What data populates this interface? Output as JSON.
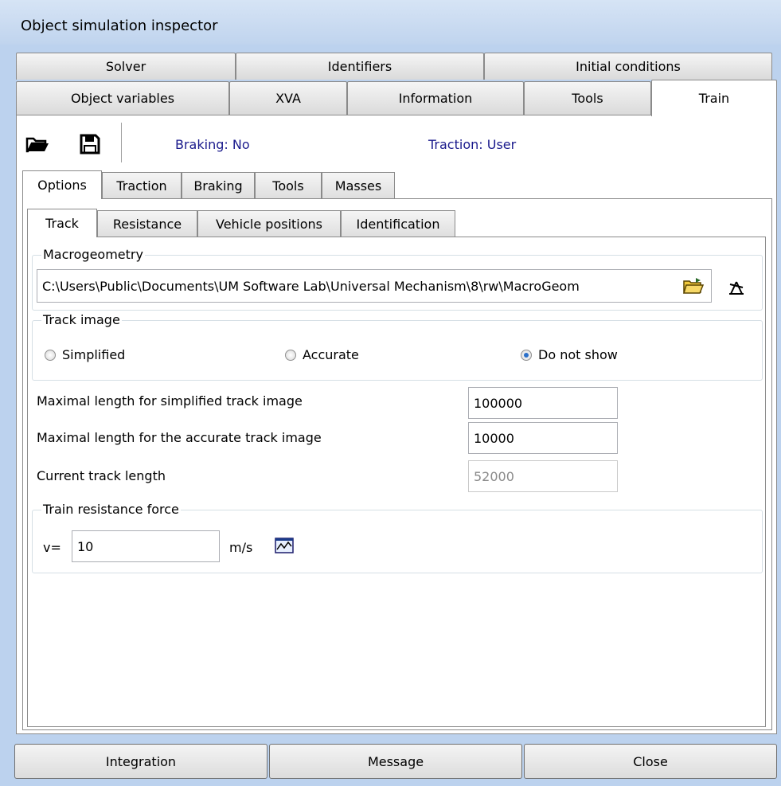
{
  "window": {
    "title": "Object simulation inspector"
  },
  "main_tabs_row1": [
    "Solver",
    "Identifiers",
    "Initial conditions"
  ],
  "main_tabs_row2": [
    "Object variables",
    "XVA",
    "Information",
    "Tools",
    "Train"
  ],
  "toolbar": {
    "open_icon": "folder-open-icon",
    "save_icon": "save-icon",
    "braking_status": "Braking: No",
    "traction_status": "Traction: User"
  },
  "sub_tabs": [
    "Options",
    "Traction",
    "Braking",
    "Tools",
    "Masses"
  ],
  "inner_tabs": [
    "Track",
    "Resistance",
    "Vehicle positions",
    "Identification"
  ],
  "macrogeometry": {
    "title": "Macrogeometry",
    "path": "C:\\Users\\Public\\Documents\\UM Software Lab\\Universal Mechanism\\8\\rw\\MacroGeom",
    "browse_icon": "folder-browse-icon",
    "view_icon": "track-geometry-icon"
  },
  "track_image": {
    "title": "Track image",
    "options": [
      "Simplified",
      "Accurate",
      "Do not show"
    ],
    "selected": "Do not show"
  },
  "fields": {
    "max_simplified_label": "Maximal length for simplified track image",
    "max_simplified_value": "100000",
    "max_accurate_label": "Maximal length for the accurate track image",
    "max_accurate_value": "10000",
    "current_length_label": "Current track length",
    "current_length_value": "52000"
  },
  "resistance": {
    "title": "Train resistance force",
    "v_label": "v=",
    "v_value": "10",
    "unit": "m/s",
    "plot_icon": "graph-icon"
  },
  "bottom_buttons": [
    "Integration",
    "Message",
    "Close"
  ]
}
